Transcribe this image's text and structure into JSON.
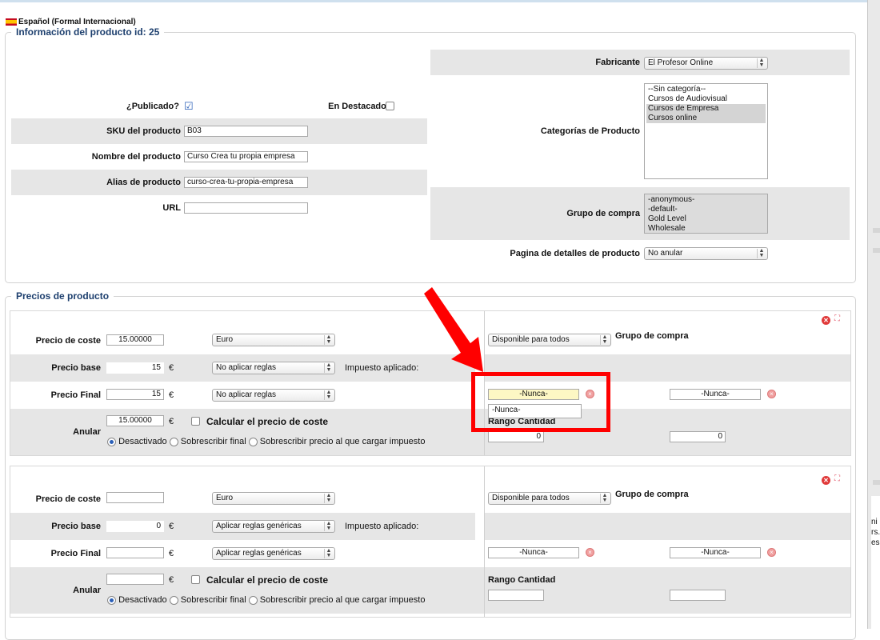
{
  "language": "Español (Formal Internacional)",
  "info_legend": "Información del producto id: 25",
  "left_fields": {
    "published_label": "¿Publicado?",
    "featured_label": "En Destacados",
    "sku_label": "SKU del producto",
    "sku_value": "B03",
    "name_label": "Nombre del producto",
    "name_value": "Curso Crea tu propia empresa",
    "alias_label": "Alias de producto",
    "alias_value": "curso-crea-tu-propia-empresa",
    "url_label": "URL",
    "url_value": ""
  },
  "right_fields": {
    "manufacturer_label": "Fabricante",
    "manufacturer_value": "El Profesor Online",
    "categories_label": "Categorías de Producto",
    "categories": [
      "--Sin categoría--",
      "Cursos de Audiovisual",
      "Cursos de Empresa",
      "Cursos online"
    ],
    "shopper_group_label": "Grupo de compra",
    "shopper_groups": [
      "-anonymous-",
      "-default-",
      "Gold Level",
      "Wholesale"
    ],
    "details_page_label": "Pagina de detalles de producto",
    "details_page_value": "No anular"
  },
  "prices_legend": "Precios de producto",
  "price_blocks": [
    {
      "cost_label": "Precio de coste",
      "cost_value": "15.00000",
      "currency": "Euro",
      "base_label": "Precio base",
      "base_value": "15",
      "euro": "€",
      "base_rule": "No aplicar reglas",
      "tax_applied": "Impuesto aplicado:",
      "final_label": "Precio Final",
      "final_value": "15",
      "final_rule": "No aplicar reglas",
      "override_label": "Anular",
      "override_value": "15.00000",
      "calc_cost": "Calcular el precio de coste",
      "radio_disabled": "Desactivado",
      "radio_overwrite": "Sobrescribir final",
      "radio_tax": "Sobrescribir precio al que cargar impuesto",
      "availability": "Disponible para todos",
      "shopper_group": "Grupo de compra",
      "date_from": "-Nunca-",
      "date_to": "-Nunca-",
      "dropdown_option": "-Nunca-",
      "qty_label": "Rango Cantidad",
      "qty_from": "0",
      "qty_to": "0"
    },
    {
      "cost_label": "Precio de coste",
      "cost_value": "",
      "currency": "Euro",
      "base_label": "Precio base",
      "base_value": "0",
      "euro": "€",
      "base_rule": "Aplicar reglas genéricas",
      "tax_applied": "Impuesto aplicado:",
      "final_label": "Precio Final",
      "final_value": "",
      "final_rule": "Aplicar reglas genéricas",
      "override_label": "Anular",
      "override_value": "",
      "calc_cost": "Calcular el precio de coste",
      "radio_disabled": "Desactivado",
      "radio_overwrite": "Sobrescribir final",
      "radio_tax": "Sobrescribir precio al que cargar impuesto",
      "availability": "Disponible para todos",
      "shopper_group": "Grupo de compra",
      "date_from": "-Nunca-",
      "date_to": "-Nunca-",
      "qty_label": "Rango Cantidad",
      "qty_from": "",
      "qty_to": ""
    }
  ],
  "right_edge_text": [
    "ni",
    "rs.",
    "es"
  ],
  "colors": {
    "legend": "#1d3f6e",
    "highlight_box": "#ff0000",
    "arrow": "#ff0000",
    "row_gray": "#e6e6e6"
  }
}
